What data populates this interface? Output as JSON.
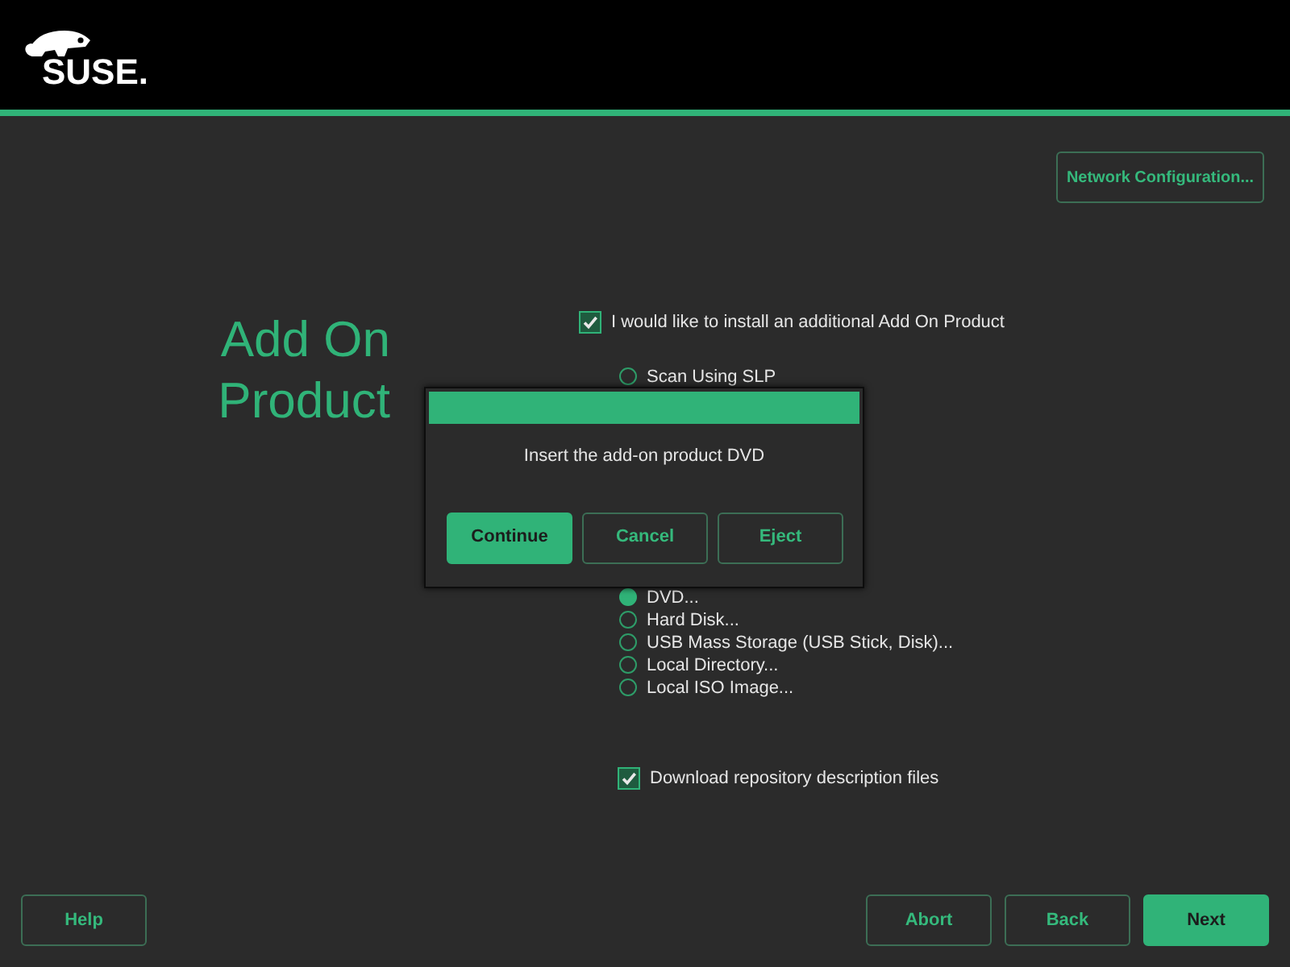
{
  "header": {
    "logo": "SUSE."
  },
  "network_button": "Network Configuration...",
  "title": "Add On Product",
  "addon_checkbox": {
    "label": "I would like to install an additional Add On Product",
    "checked": true
  },
  "sources": [
    {
      "label": "Scan Using SLP",
      "selected": false
    },
    {
      "label": "DVD...",
      "selected": true
    },
    {
      "label": "Hard Disk...",
      "selected": false
    },
    {
      "label": "USB Mass Storage (USB Stick, Disk)...",
      "selected": false
    },
    {
      "label": "Local Directory...",
      "selected": false
    },
    {
      "label": "Local ISO Image...",
      "selected": false
    }
  ],
  "download_checkbox": {
    "label": "Download repository description files",
    "checked": true
  },
  "dialog": {
    "message": "Insert the add-on product DVD",
    "buttons": [
      {
        "label": "Continue",
        "kind": "primary"
      },
      {
        "label": "Cancel",
        "kind": "outline"
      },
      {
        "label": "Eject",
        "kind": "outline"
      }
    ]
  },
  "footer": {
    "left": [
      {
        "label": "Help",
        "kind": "outline"
      }
    ],
    "right": [
      {
        "label": "Abort",
        "kind": "outline"
      },
      {
        "label": "Back",
        "kind": "outline"
      },
      {
        "label": "Next",
        "kind": "primary"
      }
    ]
  }
}
